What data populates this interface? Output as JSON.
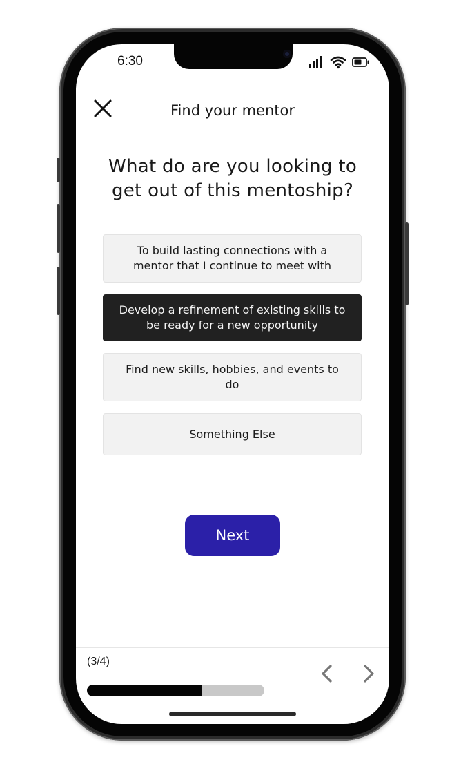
{
  "status_bar": {
    "time": "6:30",
    "icons": [
      "signal-icon",
      "wifi-icon",
      "battery-icon"
    ]
  },
  "header": {
    "title": "Find your mentor",
    "close_icon": "close-icon"
  },
  "question": {
    "line1": "What do are you looking to",
    "line2": "get out of this mentoship?"
  },
  "options": [
    {
      "label": "To build lasting connections with a mentor that I continue to meet with",
      "selected": false
    },
    {
      "label": "Develop a refinement of existing skills to be ready for a new opportunity",
      "selected": true
    },
    {
      "label": "Find new skills, hobbies, and events to do",
      "selected": false
    },
    {
      "label": "Something Else",
      "selected": false
    }
  ],
  "next_button": {
    "label": "Next",
    "color": "#2b20a8"
  },
  "footer": {
    "step": "(3/4)",
    "progress": 0.65,
    "prev_icon": "chevron-left-icon",
    "next_icon": "chevron-right-icon"
  },
  "colors": {
    "selected_option": "#212121",
    "option_bg": "#f2f2f2",
    "accent": "#2b20a8"
  }
}
